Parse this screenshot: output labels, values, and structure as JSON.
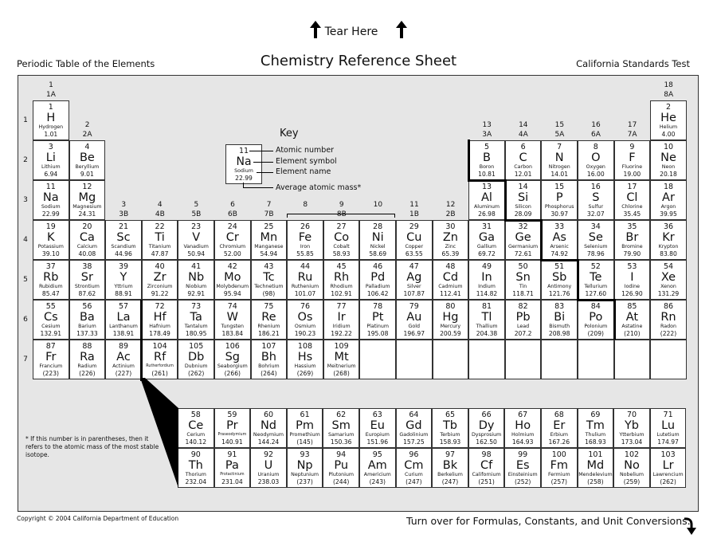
{
  "tear_label": "Tear Here",
  "header": {
    "left": "Periodic Table of the Elements",
    "center": "Chemistry Reference Sheet",
    "right": "California Standards Test"
  },
  "periods": [
    "1",
    "2",
    "3",
    "4",
    "5",
    "6",
    "7"
  ],
  "groups": [
    {
      "col": 1,
      "num": "1",
      "label": "1A"
    },
    {
      "col": 2,
      "num": "2",
      "label": "2A"
    },
    {
      "col": 3,
      "num": "3",
      "label": "3B"
    },
    {
      "col": 4,
      "num": "4",
      "label": "4B"
    },
    {
      "col": 5,
      "num": "5",
      "label": "5B"
    },
    {
      "col": 6,
      "num": "6",
      "label": "6B"
    },
    {
      "col": 7,
      "num": "7",
      "label": "7B"
    },
    {
      "col": 8,
      "num": "8",
      "label": ""
    },
    {
      "col": 9,
      "num": "9",
      "label": "8B"
    },
    {
      "col": 10,
      "num": "10",
      "label": ""
    },
    {
      "col": 11,
      "num": "11",
      "label": "1B"
    },
    {
      "col": 12,
      "num": "12",
      "label": "2B"
    },
    {
      "col": 13,
      "num": "13",
      "label": "3A"
    },
    {
      "col": 14,
      "num": "14",
      "label": "4A"
    },
    {
      "col": 15,
      "num": "15",
      "label": "5A"
    },
    {
      "col": 16,
      "num": "16",
      "label": "6A"
    },
    {
      "col": 17,
      "num": "17",
      "label": "7A"
    },
    {
      "col": 18,
      "num": "18",
      "label": "8A"
    }
  ],
  "key": {
    "title": "Key",
    "example": {
      "num": "11",
      "sym": "Na",
      "name": "Sodium",
      "mass": "22.99"
    },
    "labels": {
      "atomic_number": "Atomic number",
      "element_symbol": "Element symbol",
      "element_name": "Element name",
      "average_mass": "Average atomic mass*"
    }
  },
  "elements": [
    {
      "n": "1",
      "s": "H",
      "name": "Hydrogen",
      "m": "1.01",
      "r": 1,
      "c": 1
    },
    {
      "n": "2",
      "s": "He",
      "name": "Helium",
      "m": "4.00",
      "r": 1,
      "c": 18
    },
    {
      "n": "3",
      "s": "Li",
      "name": "Lithium",
      "m": "6.94",
      "r": 2,
      "c": 1
    },
    {
      "n": "4",
      "s": "Be",
      "name": "Beryllium",
      "m": "9.01",
      "r": 2,
      "c": 2
    },
    {
      "n": "5",
      "s": "B",
      "name": "Boron",
      "m": "10.81",
      "r": 2,
      "c": 13
    },
    {
      "n": "6",
      "s": "C",
      "name": "Carbon",
      "m": "12.01",
      "r": 2,
      "c": 14
    },
    {
      "n": "7",
      "s": "N",
      "name": "Nitrogen",
      "m": "14.01",
      "r": 2,
      "c": 15
    },
    {
      "n": "8",
      "s": "O",
      "name": "Oxygen",
      "m": "16.00",
      "r": 2,
      "c": 16
    },
    {
      "n": "9",
      "s": "F",
      "name": "Fluorine",
      "m": "19.00",
      "r": 2,
      "c": 17
    },
    {
      "n": "10",
      "s": "Ne",
      "name": "Neon",
      "m": "20.18",
      "r": 2,
      "c": 18
    },
    {
      "n": "11",
      "s": "Na",
      "name": "Sodium",
      "m": "22.99",
      "r": 3,
      "c": 1
    },
    {
      "n": "12",
      "s": "Mg",
      "name": "Magnesium",
      "m": "24.31",
      "r": 3,
      "c": 2
    },
    {
      "n": "13",
      "s": "Al",
      "name": "Aluminum",
      "m": "26.98",
      "r": 3,
      "c": 13
    },
    {
      "n": "14",
      "s": "Si",
      "name": "Silicon",
      "m": "28.09",
      "r": 3,
      "c": 14
    },
    {
      "n": "15",
      "s": "P",
      "name": "Phosphorus",
      "m": "30.97",
      "r": 3,
      "c": 15
    },
    {
      "n": "16",
      "s": "S",
      "name": "Sulfur",
      "m": "32.07",
      "r": 3,
      "c": 16
    },
    {
      "n": "17",
      "s": "Cl",
      "name": "Chlorine",
      "m": "35.45",
      "r": 3,
      "c": 17
    },
    {
      "n": "18",
      "s": "Ar",
      "name": "Argon",
      "m": "39.95",
      "r": 3,
      "c": 18
    },
    {
      "n": "19",
      "s": "K",
      "name": "Potassium",
      "m": "39.10",
      "r": 4,
      "c": 1
    },
    {
      "n": "20",
      "s": "Ca",
      "name": "Calcium",
      "m": "40.08",
      "r": 4,
      "c": 2
    },
    {
      "n": "21",
      "s": "Sc",
      "name": "Scandium",
      "m": "44.96",
      "r": 4,
      "c": 3
    },
    {
      "n": "22",
      "s": "Ti",
      "name": "Titanium",
      "m": "47.87",
      "r": 4,
      "c": 4
    },
    {
      "n": "23",
      "s": "V",
      "name": "Vanadium",
      "m": "50.94",
      "r": 4,
      "c": 5
    },
    {
      "n": "24",
      "s": "Cr",
      "name": "Chromium",
      "m": "52.00",
      "r": 4,
      "c": 6
    },
    {
      "n": "25",
      "s": "Mn",
      "name": "Manganese",
      "m": "54.94",
      "r": 4,
      "c": 7
    },
    {
      "n": "26",
      "s": "Fe",
      "name": "Iron",
      "m": "55.85",
      "r": 4,
      "c": 8
    },
    {
      "n": "27",
      "s": "Co",
      "name": "Cobalt",
      "m": "58.93",
      "r": 4,
      "c": 9
    },
    {
      "n": "28",
      "s": "Ni",
      "name": "Nickel",
      "m": "58.69",
      "r": 4,
      "c": 10
    },
    {
      "n": "29",
      "s": "Cu",
      "name": "Copper",
      "m": "63.55",
      "r": 4,
      "c": 11
    },
    {
      "n": "30",
      "s": "Zn",
      "name": "Zinc",
      "m": "65.39",
      "r": 4,
      "c": 12
    },
    {
      "n": "31",
      "s": "Ga",
      "name": "Gallium",
      "m": "69.72",
      "r": 4,
      "c": 13
    },
    {
      "n": "32",
      "s": "Ge",
      "name": "Germanium",
      "m": "72.61",
      "r": 4,
      "c": 14
    },
    {
      "n": "33",
      "s": "As",
      "name": "Arsenic",
      "m": "74.92",
      "r": 4,
      "c": 15
    },
    {
      "n": "34",
      "s": "Se",
      "name": "Selenium",
      "m": "78.96",
      "r": 4,
      "c": 16
    },
    {
      "n": "35",
      "s": "Br",
      "name": "Bromine",
      "m": "79.90",
      "r": 4,
      "c": 17
    },
    {
      "n": "36",
      "s": "Kr",
      "name": "Krypton",
      "m": "83.80",
      "r": 4,
      "c": 18
    },
    {
      "n": "37",
      "s": "Rb",
      "name": "Rubidium",
      "m": "85.47",
      "r": 5,
      "c": 1
    },
    {
      "n": "38",
      "s": "Sr",
      "name": "Strontium",
      "m": "87.62",
      "r": 5,
      "c": 2
    },
    {
      "n": "39",
      "s": "Y",
      "name": "Yttrium",
      "m": "88.91",
      "r": 5,
      "c": 3
    },
    {
      "n": "40",
      "s": "Zr",
      "name": "Zirconium",
      "m": "91.22",
      "r": 5,
      "c": 4
    },
    {
      "n": "41",
      "s": "Nb",
      "name": "Niobium",
      "m": "92.91",
      "r": 5,
      "c": 5
    },
    {
      "n": "42",
      "s": "Mo",
      "name": "Molybdenum",
      "m": "95.94",
      "r": 5,
      "c": 6
    },
    {
      "n": "43",
      "s": "Tc",
      "name": "Technetium",
      "m": "(98)",
      "r": 5,
      "c": 7
    },
    {
      "n": "44",
      "s": "Ru",
      "name": "Ruthenium",
      "m": "101.07",
      "r": 5,
      "c": 8
    },
    {
      "n": "45",
      "s": "Rh",
      "name": "Rhodium",
      "m": "102.91",
      "r": 5,
      "c": 9
    },
    {
      "n": "46",
      "s": "Pd",
      "name": "Palladium",
      "m": "106.42",
      "r": 5,
      "c": 10
    },
    {
      "n": "47",
      "s": "Ag",
      "name": "Silver",
      "m": "107.87",
      "r": 5,
      "c": 11
    },
    {
      "n": "48",
      "s": "Cd",
      "name": "Cadmium",
      "m": "112.41",
      "r": 5,
      "c": 12
    },
    {
      "n": "49",
      "s": "In",
      "name": "Indium",
      "m": "114.82",
      "r": 5,
      "c": 13
    },
    {
      "n": "50",
      "s": "Sn",
      "name": "Tin",
      "m": "118.71",
      "r": 5,
      "c": 14
    },
    {
      "n": "51",
      "s": "Sb",
      "name": "Antimony",
      "m": "121.76",
      "r": 5,
      "c": 15
    },
    {
      "n": "52",
      "s": "Te",
      "name": "Tellurium",
      "m": "127.60",
      "r": 5,
      "c": 16
    },
    {
      "n": "53",
      "s": "I",
      "name": "Iodine",
      "m": "126.90",
      "r": 5,
      "c": 17
    },
    {
      "n": "54",
      "s": "Xe",
      "name": "Xenon",
      "m": "131.29",
      "r": 5,
      "c": 18
    },
    {
      "n": "55",
      "s": "Cs",
      "name": "Cesium",
      "m": "132.91",
      "r": 6,
      "c": 1
    },
    {
      "n": "56",
      "s": "Ba",
      "name": "Barium",
      "m": "137.33",
      "r": 6,
      "c": 2
    },
    {
      "n": "57",
      "s": "La",
      "name": "Lanthanum",
      "m": "138.91",
      "r": 6,
      "c": 3
    },
    {
      "n": "72",
      "s": "Hf",
      "name": "Hafnium",
      "m": "178.49",
      "r": 6,
      "c": 4
    },
    {
      "n": "73",
      "s": "Ta",
      "name": "Tantalum",
      "m": "180.95",
      "r": 6,
      "c": 5
    },
    {
      "n": "74",
      "s": "W",
      "name": "Tungsten",
      "m": "183.84",
      "r": 6,
      "c": 6
    },
    {
      "n": "75",
      "s": "Re",
      "name": "Rhenium",
      "m": "186.21",
      "r": 6,
      "c": 7
    },
    {
      "n": "76",
      "s": "Os",
      "name": "Osmium",
      "m": "190.23",
      "r": 6,
      "c": 8
    },
    {
      "n": "77",
      "s": "Ir",
      "name": "Iridium",
      "m": "192.22",
      "r": 6,
      "c": 9
    },
    {
      "n": "78",
      "s": "Pt",
      "name": "Platinum",
      "m": "195.08",
      "r": 6,
      "c": 10
    },
    {
      "n": "79",
      "s": "Au",
      "name": "Gold",
      "m": "196.97",
      "r": 6,
      "c": 11
    },
    {
      "n": "80",
      "s": "Hg",
      "name": "Mercury",
      "m": "200.59",
      "r": 6,
      "c": 12
    },
    {
      "n": "81",
      "s": "Tl",
      "name": "Thallium",
      "m": "204.38",
      "r": 6,
      "c": 13
    },
    {
      "n": "82",
      "s": "Pb",
      "name": "Lead",
      "m": "207.2",
      "r": 6,
      "c": 14
    },
    {
      "n": "83",
      "s": "Bi",
      "name": "Bismuth",
      "m": "208.98",
      "r": 6,
      "c": 15
    },
    {
      "n": "84",
      "s": "Po",
      "name": "Polonium",
      "m": "(209)",
      "r": 6,
      "c": 16
    },
    {
      "n": "85",
      "s": "At",
      "name": "Astatine",
      "m": "(210)",
      "r": 6,
      "c": 17
    },
    {
      "n": "86",
      "s": "Rn",
      "name": "Radon",
      "m": "(222)",
      "r": 6,
      "c": 18
    },
    {
      "n": "87",
      "s": "Fr",
      "name": "Francium",
      "m": "(223)",
      "r": 7,
      "c": 1
    },
    {
      "n": "88",
      "s": "Ra",
      "name": "Radium",
      "m": "(226)",
      "r": 7,
      "c": 2
    },
    {
      "n": "89",
      "s": "Ac",
      "name": "Actinium",
      "m": "(227)",
      "r": 7,
      "c": 3
    },
    {
      "n": "104",
      "s": "Rf",
      "name": "Rutherfordium",
      "m": "(261)",
      "r": 7,
      "c": 4
    },
    {
      "n": "105",
      "s": "Db",
      "name": "Dubnium",
      "m": "(262)",
      "r": 7,
      "c": 5
    },
    {
      "n": "106",
      "s": "Sg",
      "name": "Seaborgium",
      "m": "(266)",
      "r": 7,
      "c": 6
    },
    {
      "n": "107",
      "s": "Bh",
      "name": "Bohrium",
      "m": "(264)",
      "r": 7,
      "c": 7
    },
    {
      "n": "108",
      "s": "Hs",
      "name": "Hassium",
      "m": "(269)",
      "r": 7,
      "c": 8
    },
    {
      "n": "109",
      "s": "Mt",
      "name": "Meitnerium",
      "m": "(268)",
      "r": 7,
      "c": 9
    }
  ],
  "empty_cells": [
    {
      "r": 7,
      "c": 10
    },
    {
      "r": 7,
      "c": 11
    },
    {
      "r": 7,
      "c": 12
    },
    {
      "r": 7,
      "c": 13
    },
    {
      "r": 7,
      "c": 14
    },
    {
      "r": 7,
      "c": 15
    },
    {
      "r": 7,
      "c": 16
    },
    {
      "r": 7,
      "c": 17
    },
    {
      "r": 7,
      "c": 18
    }
  ],
  "f_block": [
    {
      "n": "58",
      "s": "Ce",
      "name": "Cerium",
      "m": "140.12",
      "r": 1,
      "c": 1
    },
    {
      "n": "59",
      "s": "Pr",
      "name": "Praseodymium",
      "m": "140.91",
      "r": 1,
      "c": 2
    },
    {
      "n": "60",
      "s": "Nd",
      "name": "Neodymium",
      "m": "144.24",
      "r": 1,
      "c": 3
    },
    {
      "n": "61",
      "s": "Pm",
      "name": "Promethium",
      "m": "(145)",
      "r": 1,
      "c": 4
    },
    {
      "n": "62",
      "s": "Sm",
      "name": "Samarium",
      "m": "150.36",
      "r": 1,
      "c": 5
    },
    {
      "n": "63",
      "s": "Eu",
      "name": "Europium",
      "m": "151.96",
      "r": 1,
      "c": 6
    },
    {
      "n": "64",
      "s": "Gd",
      "name": "Gadolinium",
      "m": "157.25",
      "r": 1,
      "c": 7
    },
    {
      "n": "65",
      "s": "Tb",
      "name": "Terbium",
      "m": "158.93",
      "r": 1,
      "c": 8
    },
    {
      "n": "66",
      "s": "Dy",
      "name": "Dysprosium",
      "m": "162.50",
      "r": 1,
      "c": 9
    },
    {
      "n": "67",
      "s": "Ho",
      "name": "Holmium",
      "m": "164.93",
      "r": 1,
      "c": 10
    },
    {
      "n": "68",
      "s": "Er",
      "name": "Erbium",
      "m": "167.26",
      "r": 1,
      "c": 11
    },
    {
      "n": "69",
      "s": "Tm",
      "name": "Thulium",
      "m": "168.93",
      "r": 1,
      "c": 12
    },
    {
      "n": "70",
      "s": "Yb",
      "name": "Ytterbium",
      "m": "173.04",
      "r": 1,
      "c": 13
    },
    {
      "n": "71",
      "s": "Lu",
      "name": "Lutetium",
      "m": "174.97",
      "r": 1,
      "c": 14
    },
    {
      "n": "90",
      "s": "Th",
      "name": "Thorium",
      "m": "232.04",
      "r": 2,
      "c": 1
    },
    {
      "n": "91",
      "s": "Pa",
      "name": "Protactinium",
      "m": "231.04",
      "r": 2,
      "c": 2
    },
    {
      "n": "92",
      "s": "U",
      "name": "Uranium",
      "m": "238.03",
      "r": 2,
      "c": 3
    },
    {
      "n": "93",
      "s": "Np",
      "name": "Neptunium",
      "m": "(237)",
      "r": 2,
      "c": 4
    },
    {
      "n": "94",
      "s": "Pu",
      "name": "Plutonium",
      "m": "(244)",
      "r": 2,
      "c": 5
    },
    {
      "n": "95",
      "s": "Am",
      "name": "Americium",
      "m": "(243)",
      "r": 2,
      "c": 6
    },
    {
      "n": "96",
      "s": "Cm",
      "name": "Curium",
      "m": "(247)",
      "r": 2,
      "c": 7
    },
    {
      "n": "97",
      "s": "Bk",
      "name": "Berkelium",
      "m": "(247)",
      "r": 2,
      "c": 8
    },
    {
      "n": "98",
      "s": "Cf",
      "name": "Californium",
      "m": "(251)",
      "r": 2,
      "c": 9
    },
    {
      "n": "99",
      "s": "Es",
      "name": "Einsteinium",
      "m": "(252)",
      "r": 2,
      "c": 10
    },
    {
      "n": "100",
      "s": "Fm",
      "name": "Fermium",
      "m": "(257)",
      "r": 2,
      "c": 11
    },
    {
      "n": "101",
      "s": "Md",
      "name": "Mendelevium",
      "m": "(258)",
      "r": 2,
      "c": 12
    },
    {
      "n": "102",
      "s": "No",
      "name": "Nobelium",
      "m": "(259)",
      "r": 2,
      "c": 13
    },
    {
      "n": "103",
      "s": "Lr",
      "name": "Lawrencium",
      "m": "(262)",
      "r": 2,
      "c": 14
    }
  ],
  "footnote": "* If this number is in parentheses, then it refers to the atomic mass of the most stable isotope.",
  "footer": {
    "copyright": "Copyright © 2004 California Department of Education",
    "turn_over": "Turn over for Formulas, Constants, and Unit Conversions."
  }
}
